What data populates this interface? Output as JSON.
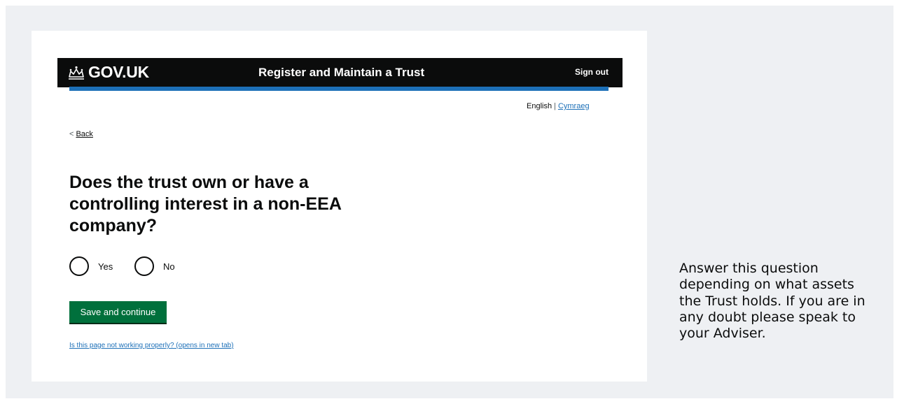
{
  "header": {
    "logo_text": "GOV.UK",
    "logo_icon": "crown-icon",
    "service_name": "Register and Maintain a Trust",
    "sign_out": "Sign out"
  },
  "language": {
    "current": "English",
    "separator": "|",
    "alternative": "Cymraeg"
  },
  "back": {
    "chevron": "<",
    "label": "Back"
  },
  "question": {
    "title": "Does the trust own or have a controlling interest in a non-EEA company?",
    "options": [
      {
        "label": "Yes",
        "selected": false
      },
      {
        "label": "No",
        "selected": false
      }
    ]
  },
  "actions": {
    "save_label": "Save and continue"
  },
  "footer": {
    "report_link": "Is this page not working properly? (opens in new tab)"
  },
  "note": {
    "text": "Answer this question depending on what assets the Trust holds. If you are in any doubt please speak to your Adviser."
  },
  "colors": {
    "header_bg": "#0b0c0c",
    "brand_blue": "#1d70b8",
    "button_green": "#00703c",
    "page_bg": "#eef0f3"
  }
}
